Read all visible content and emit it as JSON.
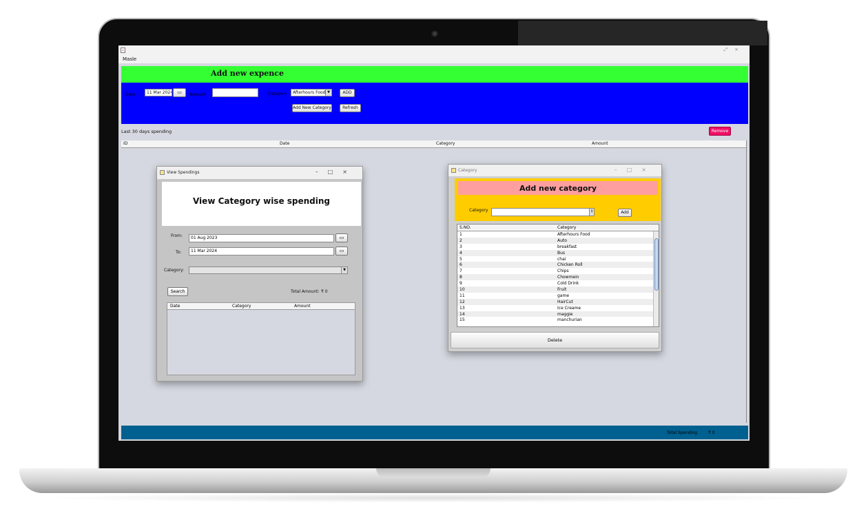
{
  "window": {
    "menu_label": "Masle"
  },
  "header": {
    "title": "Add new expence"
  },
  "expense_form": {
    "date_label": "Date",
    "date_value": "11 Mar 2024",
    "amount_label": "Amount",
    "amount_value": "",
    "category_label": "Category",
    "category_value": "Afterhours Food",
    "add_label": "ADD",
    "add_category_label": "Add New Category",
    "refresh_label": "Refresh"
  },
  "main": {
    "period_label": "Last 30 days spending",
    "remove_label": "Remove",
    "columns": [
      "ID",
      "Date",
      "Category",
      "Amount"
    ]
  },
  "status_bar": {
    "total_label": "Total Spending",
    "total_value": "₹ 0"
  },
  "view_spendings": {
    "title": "View Spendings",
    "banner": "View Category wise spending",
    "from_label": "From:",
    "from_value": "01 Aug 2023",
    "to_label": "To:",
    "to_value": "11 Mar 2024",
    "category_label": "Category:",
    "search_label": "Search",
    "total_label": "Total Amount:",
    "total_value": "₹ 0",
    "columns": [
      "Date",
      "Category",
      "Amount"
    ]
  },
  "category_window": {
    "title": "Category",
    "banner": "Add new category",
    "category_label": "Category",
    "add_label": "Add",
    "columns": [
      "S.NO.",
      "Category"
    ],
    "rows": [
      {
        "sno": "1",
        "name": "Afterhours Food"
      },
      {
        "sno": "2",
        "name": "Auto"
      },
      {
        "sno": "3",
        "name": "breakfast"
      },
      {
        "sno": "4",
        "name": "Bus"
      },
      {
        "sno": "5",
        "name": "chai"
      },
      {
        "sno": "6",
        "name": "Chicken Roll"
      },
      {
        "sno": "7",
        "name": "Chips"
      },
      {
        "sno": "8",
        "name": "Chowmein"
      },
      {
        "sno": "9",
        "name": "Cold Drink"
      },
      {
        "sno": "10",
        "name": "Fruit"
      },
      {
        "sno": "11",
        "name": "game"
      },
      {
        "sno": "12",
        "name": "HairCut"
      },
      {
        "sno": "13",
        "name": "Ice Creame"
      },
      {
        "sno": "14",
        "name": "maggie"
      },
      {
        "sno": "15",
        "name": "manchurian"
      }
    ],
    "delete_label": "Delete"
  }
}
